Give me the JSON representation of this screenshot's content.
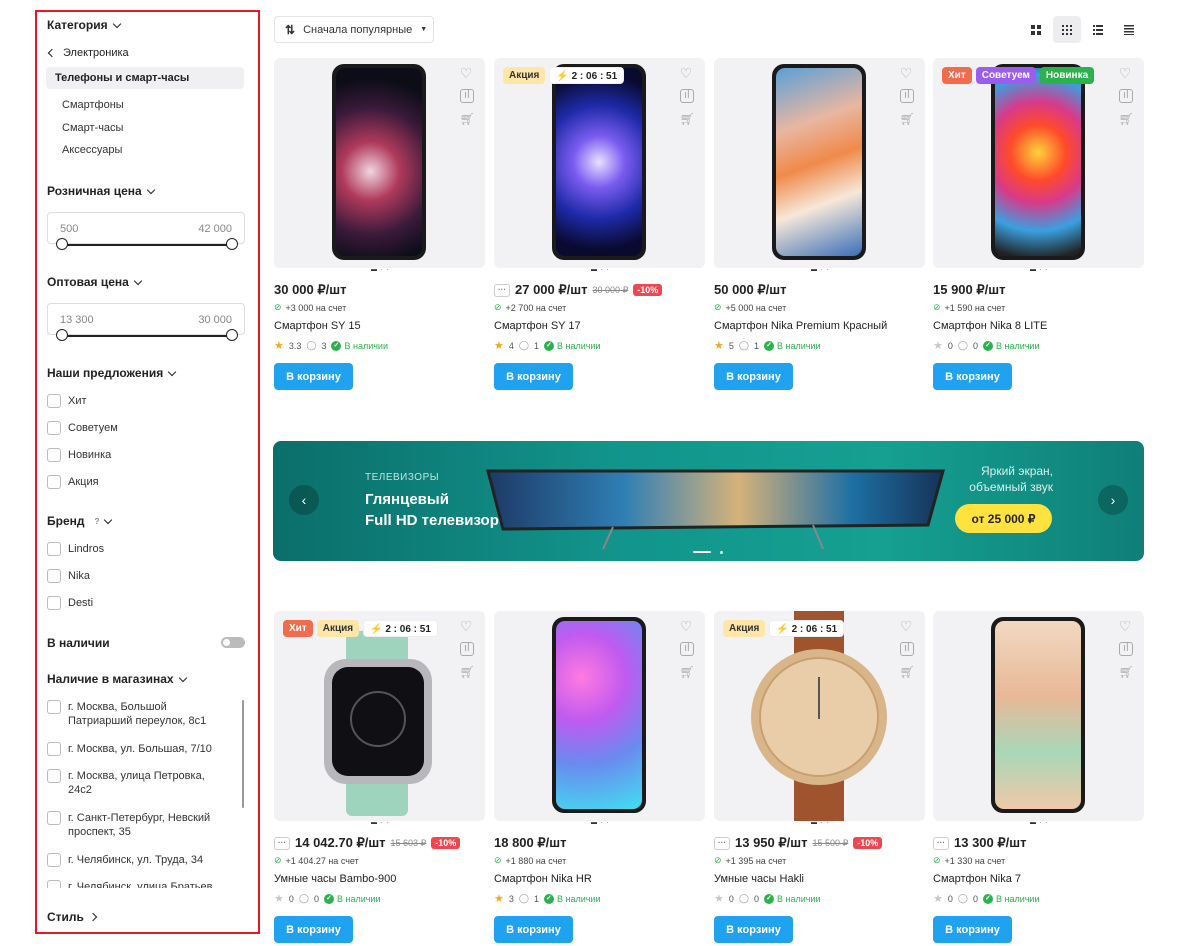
{
  "sidebar": {
    "category_title": "Категория",
    "back_label": "Электроника",
    "active_label": "Телефоны и смарт-часы",
    "subitems": [
      "Смартфоны",
      "Смарт-часы",
      "Аксессуары"
    ],
    "retail_title": "Розничная цена",
    "retail_min": "500",
    "retail_max": "42 000",
    "wholesale_title": "Оптовая цена",
    "wholesale_min": "13 300",
    "wholesale_max": "30 000",
    "offers_title": "Наши предложения",
    "offers": [
      "Хит",
      "Советуем",
      "Новинка",
      "Акция"
    ],
    "brand_title": "Бренд",
    "brand_hint": "?",
    "brands": [
      "Lindros",
      "Nika",
      "Desti"
    ],
    "in_stock_label": "В наличии",
    "stores_title": "Наличие в магазинах",
    "stores": [
      "г. Москва, Большой Патриарший переулок, 8с1",
      "г. Москва, ул. Большая, 7/10",
      "г. Москва, улица Петровка, 24с2",
      "г. Санкт-Петербург, Невский проспект, 35",
      "г. Челябинск, ул. Труда, 34",
      "г. Челябинск, улица Братьев"
    ],
    "style_title": "Стиль"
  },
  "toolbar": {
    "sort_label": "Сначала популярные"
  },
  "products": [
    {
      "price": "30 000 ₽/шт",
      "old": "",
      "discount": "",
      "bonus": "+3 000 на счет",
      "name": "Смартфон SY 15",
      "rating": "3.3",
      "comments": "3",
      "stock": "В наличии",
      "button": "В корзину",
      "badges": [],
      "timer": ""
    },
    {
      "price": "27 000 ₽/шт",
      "old": "30 000 ₽",
      "discount": "-10%",
      "bonus": "+2 700 на счет",
      "name": "Смартфон SY 17",
      "rating": "4",
      "comments": "1",
      "stock": "В наличии",
      "button": "В корзину",
      "badges": [
        "Акция"
      ],
      "timer": "2 : 06 : 51"
    },
    {
      "price": "50 000 ₽/шт",
      "old": "",
      "discount": "",
      "bonus": "+5 000 на счет",
      "name": "Смартфон Nika Premium Красный",
      "rating": "5",
      "comments": "1",
      "stock": "В наличии",
      "button": "В корзину",
      "badges": [],
      "timer": ""
    },
    {
      "price": "15 900 ₽/шт",
      "old": "",
      "discount": "",
      "bonus": "+1 590 на счет",
      "name": "Смартфон Nika 8 LITE",
      "rating": "0",
      "comments": "0",
      "stock": "В наличии",
      "button": "В корзину",
      "badges": [
        "Хит",
        "Советуем",
        "Новинка"
      ],
      "timer": ""
    },
    {
      "price": "14 042.70 ₽/шт",
      "old": "15 603 ₽",
      "discount": "-10%",
      "bonus": "+1 404.27 на счет",
      "name": "Умные часы Bambo-900",
      "rating": "0",
      "comments": "0",
      "stock": "В наличии",
      "button": "В корзину",
      "badges": [
        "Хит",
        "Акция"
      ],
      "timer": "2 : 06 : 51"
    },
    {
      "price": "18 800 ₽/шт",
      "old": "",
      "discount": "",
      "bonus": "+1 880 на счет",
      "name": "Смартфон Nika HR",
      "rating": "3",
      "comments": "1",
      "stock": "В наличии",
      "button": "В корзину",
      "badges": [],
      "timer": ""
    },
    {
      "price": "13 950 ₽/шт",
      "old": "15 500 ₽",
      "discount": "-10%",
      "bonus": "+1 395 на счет",
      "name": "Умные часы Hakli",
      "rating": "0",
      "comments": "0",
      "stock": "В наличии",
      "button": "В корзину",
      "badges": [
        "Акция"
      ],
      "timer": "2 : 06 : 51"
    },
    {
      "price": "13 300 ₽/шт",
      "old": "",
      "discount": "",
      "bonus": "+1 330 на счет",
      "name": "Смартфон Nika 7",
      "rating": "0",
      "comments": "0",
      "stock": "В наличии",
      "button": "В корзину",
      "badges": [],
      "timer": ""
    }
  ],
  "banner": {
    "kicker": "ТЕЛЕВИЗОРЫ",
    "title_line1": "Глянцевый",
    "title_line2": "Full HD телевизор",
    "side_line1": "Яркий экран,",
    "side_line2": "объемный звук",
    "cta": "от 25 000 ₽"
  },
  "colors": {
    "accent": "#1fa2f0",
    "hit": "#f26b4b",
    "sale": "#fde6a8",
    "recommend": "#9b5cf0",
    "new": "#2bb24c",
    "discount": "#f2464f"
  }
}
